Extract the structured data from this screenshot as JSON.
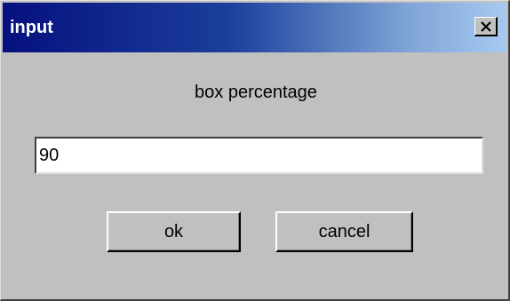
{
  "window": {
    "title": "input",
    "close_icon": "close-icon"
  },
  "dialog": {
    "prompt": "box percentage",
    "input_value": "90",
    "ok_label": "ok",
    "cancel_label": "cancel"
  },
  "colors": {
    "title_gradient_start": "#06107e",
    "title_gradient_end": "#a6caf0",
    "face": "#c0c0c0"
  }
}
